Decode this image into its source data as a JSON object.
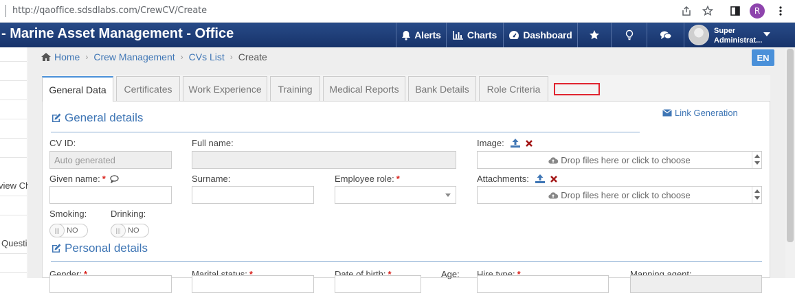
{
  "browser": {
    "url": "http://qaoffice.sdsdlabs.com/CrewCV/Create",
    "profile_initial": "R"
  },
  "header": {
    "app_title": "- Marine Asset Management - Office",
    "nav": {
      "alerts": "Alerts",
      "charts": "Charts",
      "dashboard": "Dashboard"
    },
    "user_name_line1": "Super",
    "user_name_line2": "Administrat..."
  },
  "left_strip": {
    "item_1": "view Ch",
    "item_2": "Questi"
  },
  "breadcrumb": {
    "home": "Home",
    "crew_management": "Crew Management",
    "cvs_list": "CVs List",
    "current": "Create"
  },
  "language": "EN",
  "tabs": {
    "general_data": "General Data",
    "certificates": "Certificates",
    "work_experience": "Work Experience",
    "training": "Training",
    "medical_reports": "Medical Reports",
    "bank_details": "Bank Details",
    "role_criteria": "Role Criteria"
  },
  "general": {
    "title": "General details",
    "link_generation": "Link Generation",
    "cv_id_label": "CV ID:",
    "cv_id_placeholder": "Auto generated",
    "full_name_label": "Full name:",
    "image_label": "Image:",
    "dropzone_text": "Drop files here or click to choose",
    "given_name_label": "Given name:",
    "surname_label": "Surname:",
    "employee_role_label": "Employee role:",
    "attachments_label": "Attachments:",
    "smoking_label": "Smoking:",
    "drinking_label": "Drinking:",
    "toggle_off": "NO",
    "required_mark": "*"
  },
  "personal": {
    "title": "Personal details",
    "gender_label": "Gender:",
    "marital_status_label": "Marital status:",
    "date_of_birth_label": "Date of birth:",
    "age_label": "Age:",
    "hire_type_label": "Hire type:",
    "manning_agent_label": "Manning agent:"
  },
  "colors": {
    "header_bg": "#17336a",
    "accent_blue": "#3f76b5",
    "required_red": "#d9231d",
    "marker_red": "#e0242f"
  }
}
